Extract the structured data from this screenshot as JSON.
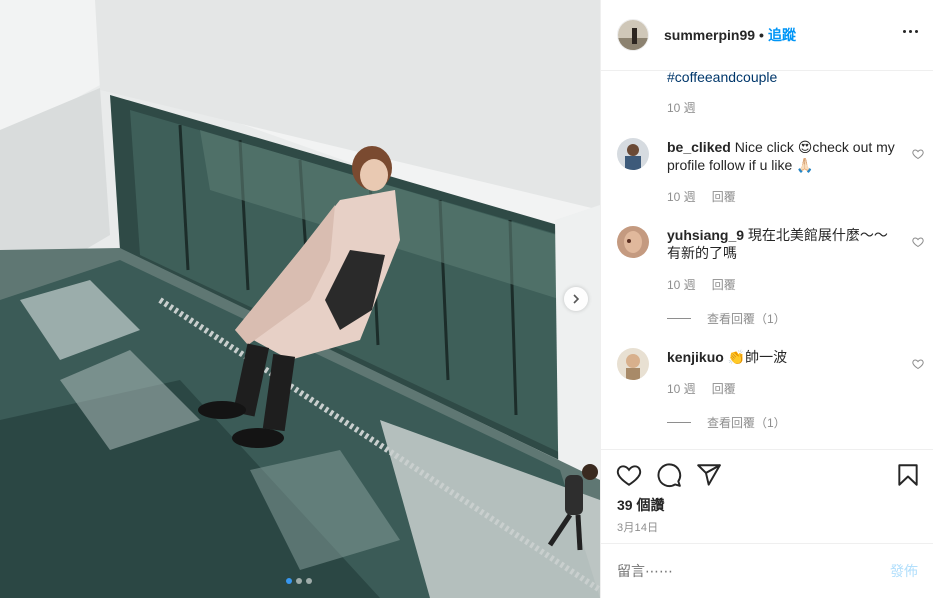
{
  "header": {
    "username": "summerpin99",
    "separator": "•",
    "follow_label": "追蹤"
  },
  "caption": {
    "hashtag": "#coffeeandcouple",
    "age": "10 週"
  },
  "comments": [
    {
      "user": "be_cliked",
      "text": "Nice click 😍check out my profile follow if u like 🙏🏻",
      "age": "10 週",
      "reply_label": "回覆"
    },
    {
      "user": "yuhsiang_9",
      "text": "現在北美館展什麼～～有新的了嗎",
      "age": "10 週",
      "reply_label": "回覆",
      "view_replies": "查看回覆（1）"
    },
    {
      "user": "kenjikuo",
      "text": "👏帥一波",
      "age": "10 週",
      "reply_label": "回覆",
      "view_replies": "查看回覆（1）"
    }
  ],
  "likes": "39 個讚",
  "date": "3月14日",
  "add_comment": {
    "placeholder": "留言⋯⋯",
    "post_label": "發佈"
  },
  "carousel": {
    "total": 3,
    "current": 1
  },
  "colors": {
    "link": "#0095f6",
    "hashtag": "#00376b",
    "muted": "#8e8e8e",
    "post_disabled": "#b2dffc",
    "active_dot": "#3897f0"
  },
  "icons": [
    "more-options-icon",
    "heart-icon",
    "comment-icon",
    "share-icon",
    "bookmark-icon",
    "chevron-right-icon"
  ]
}
